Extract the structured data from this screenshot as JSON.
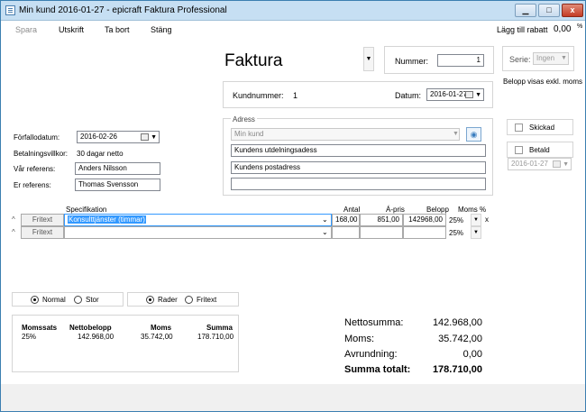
{
  "window": {
    "title": "Min kund 2016-01-27 - epicraft Faktura Professional",
    "min": "▁",
    "max": "□",
    "close": "x"
  },
  "menu": {
    "spara": "Spara",
    "utskrift": "Utskrift",
    "ta_bort": "Ta bort",
    "stang": "Stäng"
  },
  "rabatt": {
    "label": "Lägg till rabatt",
    "value": "0,00",
    "unit": "%"
  },
  "doc": {
    "title": "Faktura",
    "nummer_label": "Nummer:",
    "nummer": "1",
    "serie_label": "Serie:",
    "serie": "Ingen",
    "belopp_note": "Belopp visas exkl. moms"
  },
  "kund": {
    "label": "Kundnummer:",
    "value": "1",
    "datum_label": "Datum:",
    "datum": "2016-01-27"
  },
  "adress": {
    "label": "Adress",
    "kund": "Min kund",
    "rad1": "Kundens utdelningsadess",
    "rad2": "Kundens postadress",
    "rad3": ""
  },
  "status": {
    "skickad": "Skickad",
    "betald": "Betald",
    "betald_datum": "2016-01-27"
  },
  "left": {
    "forfallo_label": "Förfallodatum:",
    "forfallo": "2016-02-26",
    "villkor_label": "Betalningsvillkor:",
    "villkor": "30 dagar netto",
    "var_ref_label": "Vår referens:",
    "var_ref": "Anders Nilsson",
    "er_ref_label": "Er referens:",
    "er_ref": "Thomas Svensson"
  },
  "table": {
    "headers": {
      "spec": "Specifikation",
      "antal": "Antal",
      "apris": "Á-pris",
      "belopp": "Belopp",
      "moms": "Moms %"
    },
    "rows": [
      {
        "btn": "Fritext",
        "spec": "Konsulttjänster (timmar)",
        "antal": "168,00",
        "apris": "851,00",
        "belopp": "142968,00",
        "moms": "25%",
        "x": "x"
      },
      {
        "btn": "Fritext",
        "spec": "",
        "antal": "",
        "apris": "",
        "belopp": "",
        "moms": "25%"
      }
    ]
  },
  "view": {
    "normal": "Normal",
    "stor": "Stor",
    "rader": "Rader",
    "fritext": "Fritext"
  },
  "moms": {
    "headers": {
      "sats": "Momssats",
      "netto": "Nettobelopp",
      "moms": "Moms",
      "summa": "Summa"
    },
    "row": {
      "sats": "25%",
      "netto": "142.968,00",
      "moms": "35.742,00",
      "summa": "178.710,00"
    }
  },
  "totals": {
    "netto_label": "Nettosumma:",
    "netto": "142.968,00",
    "moms_label": "Moms:",
    "moms": "35.742,00",
    "avr_label": "Avrundning:",
    "avr": "0,00",
    "total_label": "Summa totalt:",
    "total": "178.710,00"
  }
}
